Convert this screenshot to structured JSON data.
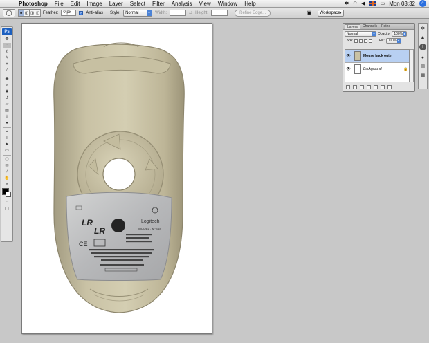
{
  "menubar": {
    "app_name": "Photoshop",
    "items": [
      "File",
      "Edit",
      "Image",
      "Layer",
      "Select",
      "Filter",
      "Analysis",
      "View",
      "Window",
      "Help"
    ],
    "clock": "Mon 03:32"
  },
  "options": {
    "feather_label": "Feather:",
    "feather_value": "0 px",
    "antialias_label": "Anti-alias",
    "style_label": "Style:",
    "style_value": "Normal",
    "width_label": "Width:",
    "height_label": "Height:",
    "refine_label": "Refine Edge...",
    "workspace_label": "Workspace"
  },
  "tools": {
    "logo": "Ps",
    "icons": [
      "move-tool",
      "marquee-tool",
      "lasso-tool",
      "quick-select-tool",
      "crop-tool",
      "eyedropper-tool",
      "healing-tool",
      "brush-tool",
      "clone-tool",
      "history-brush-tool",
      "eraser-tool",
      "gradient-tool",
      "blur-tool",
      "dodge-tool",
      "pen-tool",
      "type-tool",
      "path-select-tool",
      "shape-tool",
      "3d-tool",
      "notes-tool",
      "eyedropper2-tool",
      "hand-tool",
      "zoom-tool"
    ]
  },
  "layers_panel": {
    "tabs": [
      "Layers",
      "Channels",
      "Paths"
    ],
    "blend_mode": "Normal",
    "opacity_label": "Opacity:",
    "opacity_value": "100%",
    "lock_label": "Lock:",
    "fill_label": "Fill:",
    "fill_value": "100%",
    "layers": [
      {
        "name": "Mouse back outer",
        "selected": true
      },
      {
        "name": "Background",
        "selected": false
      }
    ]
  },
  "mouse_label": {
    "brand": "Logitech",
    "model_line": "MODEL : M-S48",
    "lines": [
      "SCAN",
      "TYPE  DESIGNED IN"
    ]
  }
}
